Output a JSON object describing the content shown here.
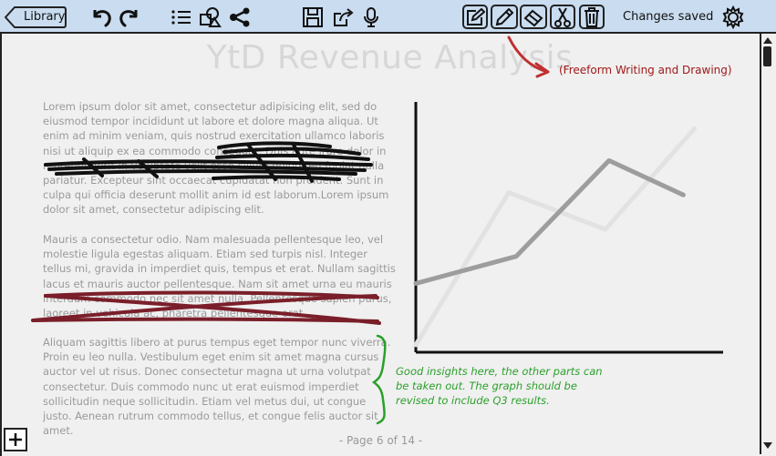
{
  "toolbar": {
    "library_label": "Library",
    "status": "Changes saved",
    "icons": [
      "undo-icon",
      "redo-icon",
      "list-icon",
      "shapes-icon",
      "share-icon",
      "save-icon",
      "export-icon",
      "microphone-icon",
      "edit-note-icon",
      "pencil-icon",
      "eraser-icon",
      "scissors-icon",
      "trash-icon",
      "settings-icon"
    ]
  },
  "document": {
    "title": "YtD Revenue Analysis",
    "paragraphs": [
      "Lorem ipsum dolor sit amet, consectetur adipisicing elit, sed do eiusmod tempor incididunt ut labore et dolore magna aliqua. Ut enim ad minim veniam, quis nostrud exercitation ullamco laboris nisi ut aliquip ex ea commodo consequat. Duis aute irure dolor in reprehenderit in voluptate velit esse cillum dolore eu fugiat nulla pariatur. Excepteur sint occaecat cupidatat non proident. Sunt in culpa qui officia deserunt mollit anim id est laborum.Lorem ipsum dolor sit amet, consectetur adipiscing elit.",
      "Mauris a consectetur odio. Nam malesuada pellentesque leo, vel molestie ligula egestas aliquam. Etiam sed turpis nisl. Integer tellus mi, gravida in imperdiet quis, tempus et erat. Nullam sagittis lacus et mauris auctor pellentesque. Nam sit amet urna eu mauris interdum commodo nec sit amet nulla. Pellentesque sapien purus, laoreet in vehicula ac, pharetra pellentesque erat.",
      "Aliquam sagittis libero at purus tempus eget tempor nunc viverra. Proin eu leo nulla. Vestibulum eget enim sit amet magna cursus auctor vel ut risus. Donec consectetur magna ut urna volutpat consectetur. Duis commodo nunc ut erat euismod imperdiet sollicitudin neque sollicitudin. Etiam vel metus dui, ut congue justo. Aenean rutrum commodo tellus, et congue felis auctor sit amet."
    ],
    "annotation": "(Freeform Writing and Drawing)",
    "comment": "Good insights here, the other parts can be taken out.  The graph should be revised to include Q3 results.",
    "page_indicator": "- Page 6 of 14 -",
    "colors": {
      "annotation": "#a01818",
      "comment": "#2aa02a",
      "strike": "#7a1f2a",
      "scribble": "#111111"
    }
  },
  "chart_data": {
    "type": "line",
    "title": "",
    "xlabel": "",
    "ylabel": "",
    "x": [
      0,
      1,
      2,
      3,
      4
    ],
    "xlim": [
      0,
      4
    ],
    "ylim": [
      0,
      10
    ],
    "grid": false,
    "series": [
      {
        "values": [
          2.8,
          3.9,
          7.8,
          6.4
        ],
        "x": [
          0,
          1.35,
          2.6,
          3.6
        ],
        "color": "#9d9d9d"
      },
      {
        "values": [
          0.3,
          6.5,
          5.0,
          9.1
        ],
        "x": [
          0,
          1.25,
          2.55,
          3.75
        ],
        "color": "#e2e2e2"
      }
    ]
  }
}
